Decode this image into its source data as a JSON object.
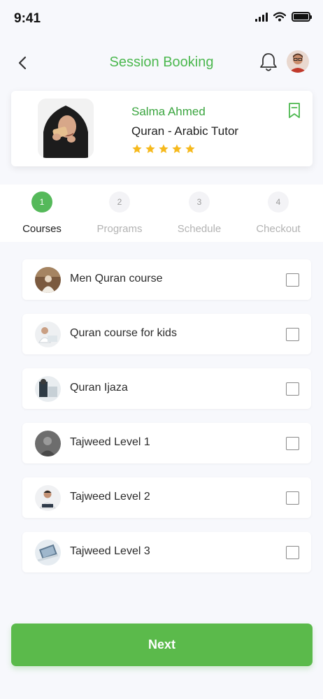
{
  "status_bar": {
    "time": "9:41",
    "icons": [
      "signal-icon",
      "wifi-icon",
      "battery-icon"
    ]
  },
  "header": {
    "title": "Session Booking",
    "back_icon": "chevron-left-icon",
    "notification_icon": "bell-icon",
    "avatar": "user-avatar"
  },
  "tutor": {
    "name": "Salma Ahmed",
    "role": "Quran - Arabic Tutor",
    "rating": 5,
    "rating_max": 5,
    "bookmark_icon": "bookmark-icon"
  },
  "steps": [
    {
      "number": "1",
      "label": "Courses",
      "active": true
    },
    {
      "number": "2",
      "label": "Programs",
      "active": false
    },
    {
      "number": "3",
      "label": "Schedule",
      "active": false
    },
    {
      "number": "4",
      "label": "Checkout",
      "active": false
    }
  ],
  "courses": [
    {
      "label": "Men Quran course",
      "checked": false
    },
    {
      "label": "Quran course for kids",
      "checked": false
    },
    {
      "label": "Quran Ijaza",
      "checked": false
    },
    {
      "label": "Tajweed Level 1",
      "checked": false
    },
    {
      "label": "Tajweed Level 2",
      "checked": false
    },
    {
      "label": "Tajweed Level 3",
      "checked": false
    }
  ],
  "next_button": {
    "label": "Next"
  },
  "colors": {
    "accent": "#4cb84f",
    "button": "#5bba4b",
    "star": "#f6b91c",
    "background": "#f7f8fc"
  }
}
